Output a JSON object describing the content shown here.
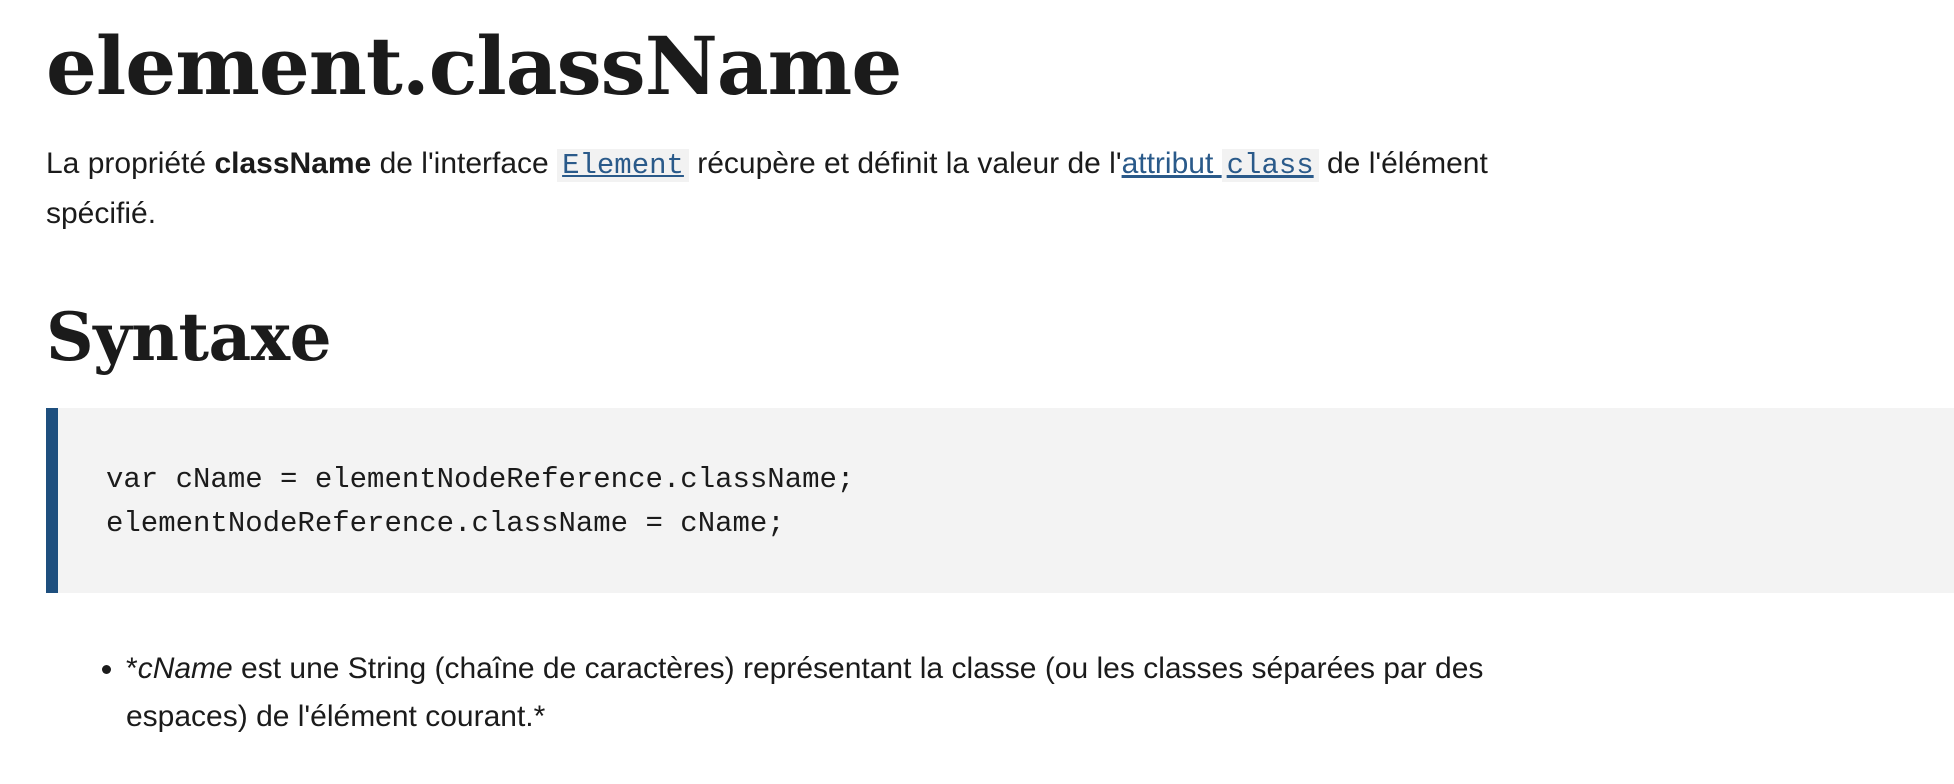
{
  "title": "element.className",
  "intro": {
    "text1": "La propriété ",
    "bold": "className",
    "text2": " de l'interface ",
    "code_link": "Element",
    "text3": " récupère et définit la valeur de l'",
    "link_text": "attribut ",
    "link_code": "class",
    "text4": " de l'élément spécifié."
  },
  "syntax": {
    "heading": "Syntaxe",
    "code_lines": [
      "var cName = elementNodeReference.className;",
      "elementNodeReference.className = cName;"
    ]
  },
  "notes": [
    {
      "prefix": "*",
      "italic": "cName",
      "rest": " est une String (chaîne de caractères) représentant la classe (ou les classes séparées par des espaces) de l'élément courant.*"
    }
  ],
  "colors": {
    "link": "#2a5a8a",
    "code_border": "#1e4f7e",
    "code_background": "#f3f3f3",
    "text": "#1b1b1b"
  }
}
